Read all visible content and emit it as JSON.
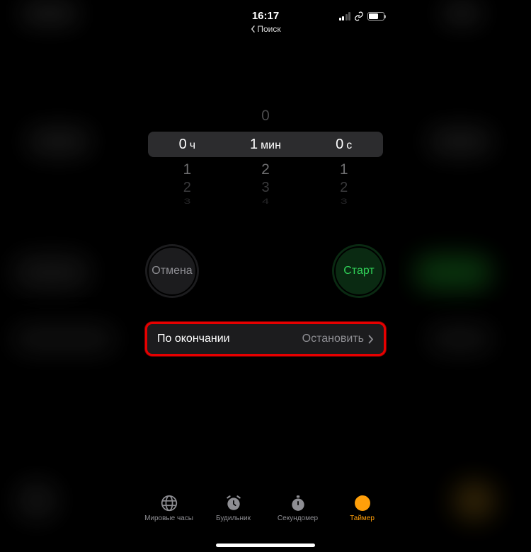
{
  "status": {
    "time": "16:17",
    "back_label": "Поиск"
  },
  "picker": {
    "hours": {
      "value": "0",
      "unit": "ч",
      "above": "",
      "below": [
        "1",
        "2",
        "3"
      ]
    },
    "minutes": {
      "value": "1",
      "unit": "мин",
      "above": "0",
      "below": [
        "2",
        "3",
        "4"
      ]
    },
    "seconds": {
      "value": "0",
      "unit": "с",
      "above": "",
      "below": [
        "1",
        "2",
        "3"
      ]
    }
  },
  "buttons": {
    "cancel": "Отмена",
    "start": "Старт"
  },
  "end_action": {
    "label": "По окончании",
    "value": "Остановить"
  },
  "tabs": {
    "world": "Мировые часы",
    "alarm": "Будильник",
    "stopwatch": "Секундомер",
    "timer": "Таймер"
  }
}
